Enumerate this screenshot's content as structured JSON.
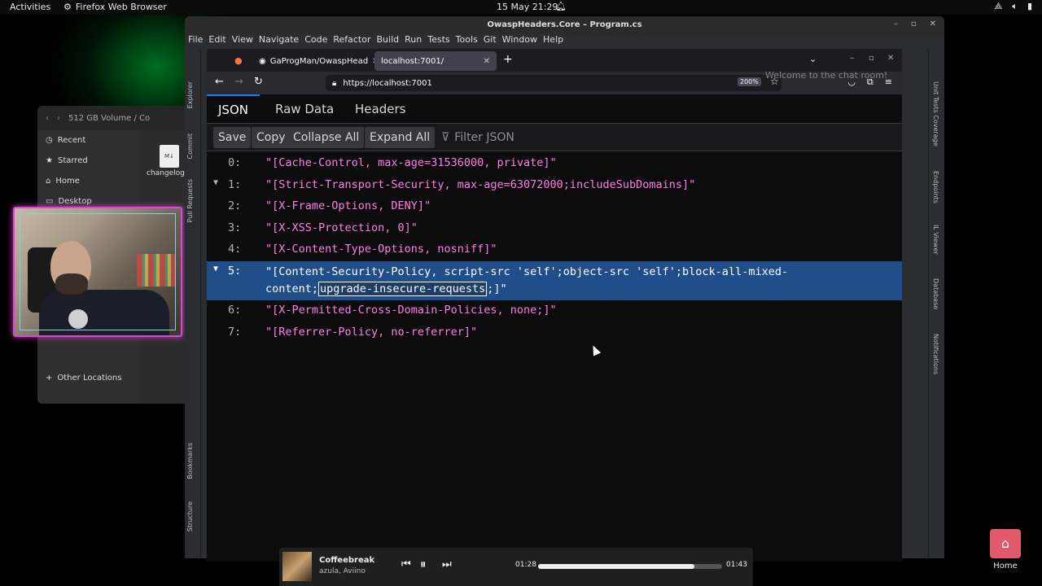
{
  "topbar": {
    "activities": "Activities",
    "app": "Firefox Web Browser",
    "datetime": "15 May  21:29"
  },
  "files": {
    "path_volume": "512 GB Volume",
    "path_sep": "/",
    "path_next": "Co",
    "sidebar": [
      "Recent",
      "Starred",
      "Home",
      "Desktop"
    ],
    "other_locations": "Other Locations",
    "file_name": "changelog.md",
    "file_badge": "M↓"
  },
  "ide": {
    "title": "OwaspHeaders.Core – Program.cs",
    "menu": [
      "File",
      "Edit",
      "View",
      "Navigate",
      "Code",
      "Refactor",
      "Build",
      "Run",
      "Tests",
      "Tools",
      "Git",
      "Window",
      "Help"
    ],
    "left_tabs": [
      "Explorer",
      "Commit",
      "Pull Requests",
      "Bookmarks",
      "Structure"
    ],
    "right_tabs": [
      "Unit Tests Coverage",
      "Endpoints",
      "IL Viewer",
      "Database",
      "Notifications"
    ]
  },
  "firefox": {
    "tabs": [
      {
        "label": "GaProgMan/OwaspHead",
        "active": false
      },
      {
        "label": "localhost:7001/",
        "active": true
      }
    ],
    "url": "https://localhost:7001",
    "zoom": "200%",
    "ghost_text": "Welcome to the chat room!"
  },
  "json_viewer": {
    "tabs": [
      "JSON",
      "Raw Data",
      "Headers"
    ],
    "active_tab": "JSON",
    "toolbar": {
      "save": "Save",
      "copy": "Copy",
      "collapse": "Collapse All",
      "expand": "Expand All",
      "filter_placeholder": "Filter JSON"
    },
    "rows": [
      {
        "key": "0:",
        "value": "\"[Cache-Control, max-age=31536000, private]\"",
        "arrow": false
      },
      {
        "key": "1:",
        "value": "\"[Strict-Transport-Security, max-age=63072000;includeSubDomains]\"",
        "arrow": true
      },
      {
        "key": "2:",
        "value": "\"[X-Frame-Options, DENY]\"",
        "arrow": false
      },
      {
        "key": "3:",
        "value": "\"[X-XSS-Protection, 0]\"",
        "arrow": false
      },
      {
        "key": "4:",
        "value": "\"[X-Content-Type-Options, nosniff]\"",
        "arrow": false
      },
      {
        "key": "5:",
        "value_line1": "\"[Content-Security-Policy, script-src 'self';object-src 'self';block-all-mixed-",
        "value_line2_pre": "content;",
        "value_line2_hl": "upgrade-insecure-requests",
        "value_line2_post": ";]\"",
        "arrow": true,
        "selected": true
      },
      {
        "key": "6:",
        "value": "\"[X-Permitted-Cross-Domain-Policies, none;]\"",
        "arrow": false
      },
      {
        "key": "7:",
        "value": "\"[Referrer-Policy, no-referrer]\"",
        "arrow": false
      }
    ]
  },
  "media": {
    "title": "Coffeebreak",
    "artist": "azula, Aviino",
    "elapsed": "01:28",
    "total": "01:43",
    "progress_fraction": 0.85
  },
  "desktop": {
    "home_label": "Home"
  }
}
